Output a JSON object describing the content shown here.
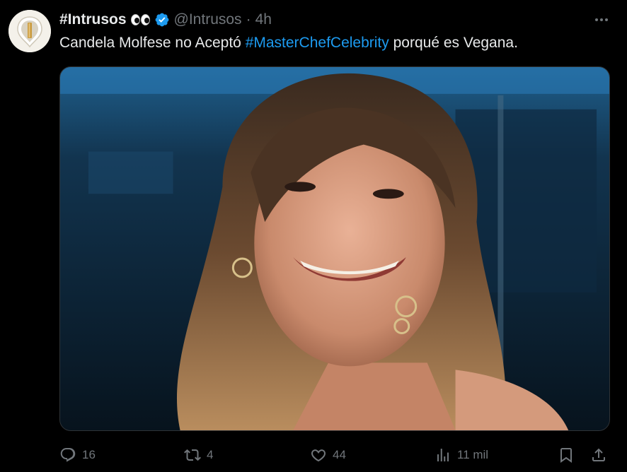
{
  "author": {
    "display_name": "#Intrusos",
    "handle": "@Intrusos",
    "separator": "·",
    "time": "4h",
    "verified": true,
    "avatar_icon": "intrusos-logo"
  },
  "tweet": {
    "text_before": "Candela Molfese no Aceptó ",
    "hashtag": "#MasterChefCelebrity",
    "text_after": " porqué es Vegana."
  },
  "actions": {
    "replies": "16",
    "retweets": "4",
    "likes": "44",
    "views": "11 mil"
  },
  "colors": {
    "background": "#000000",
    "text": "#e7e9ea",
    "muted": "#71767b",
    "link": "#1d9bf0",
    "verified": "#1d9bf0"
  }
}
